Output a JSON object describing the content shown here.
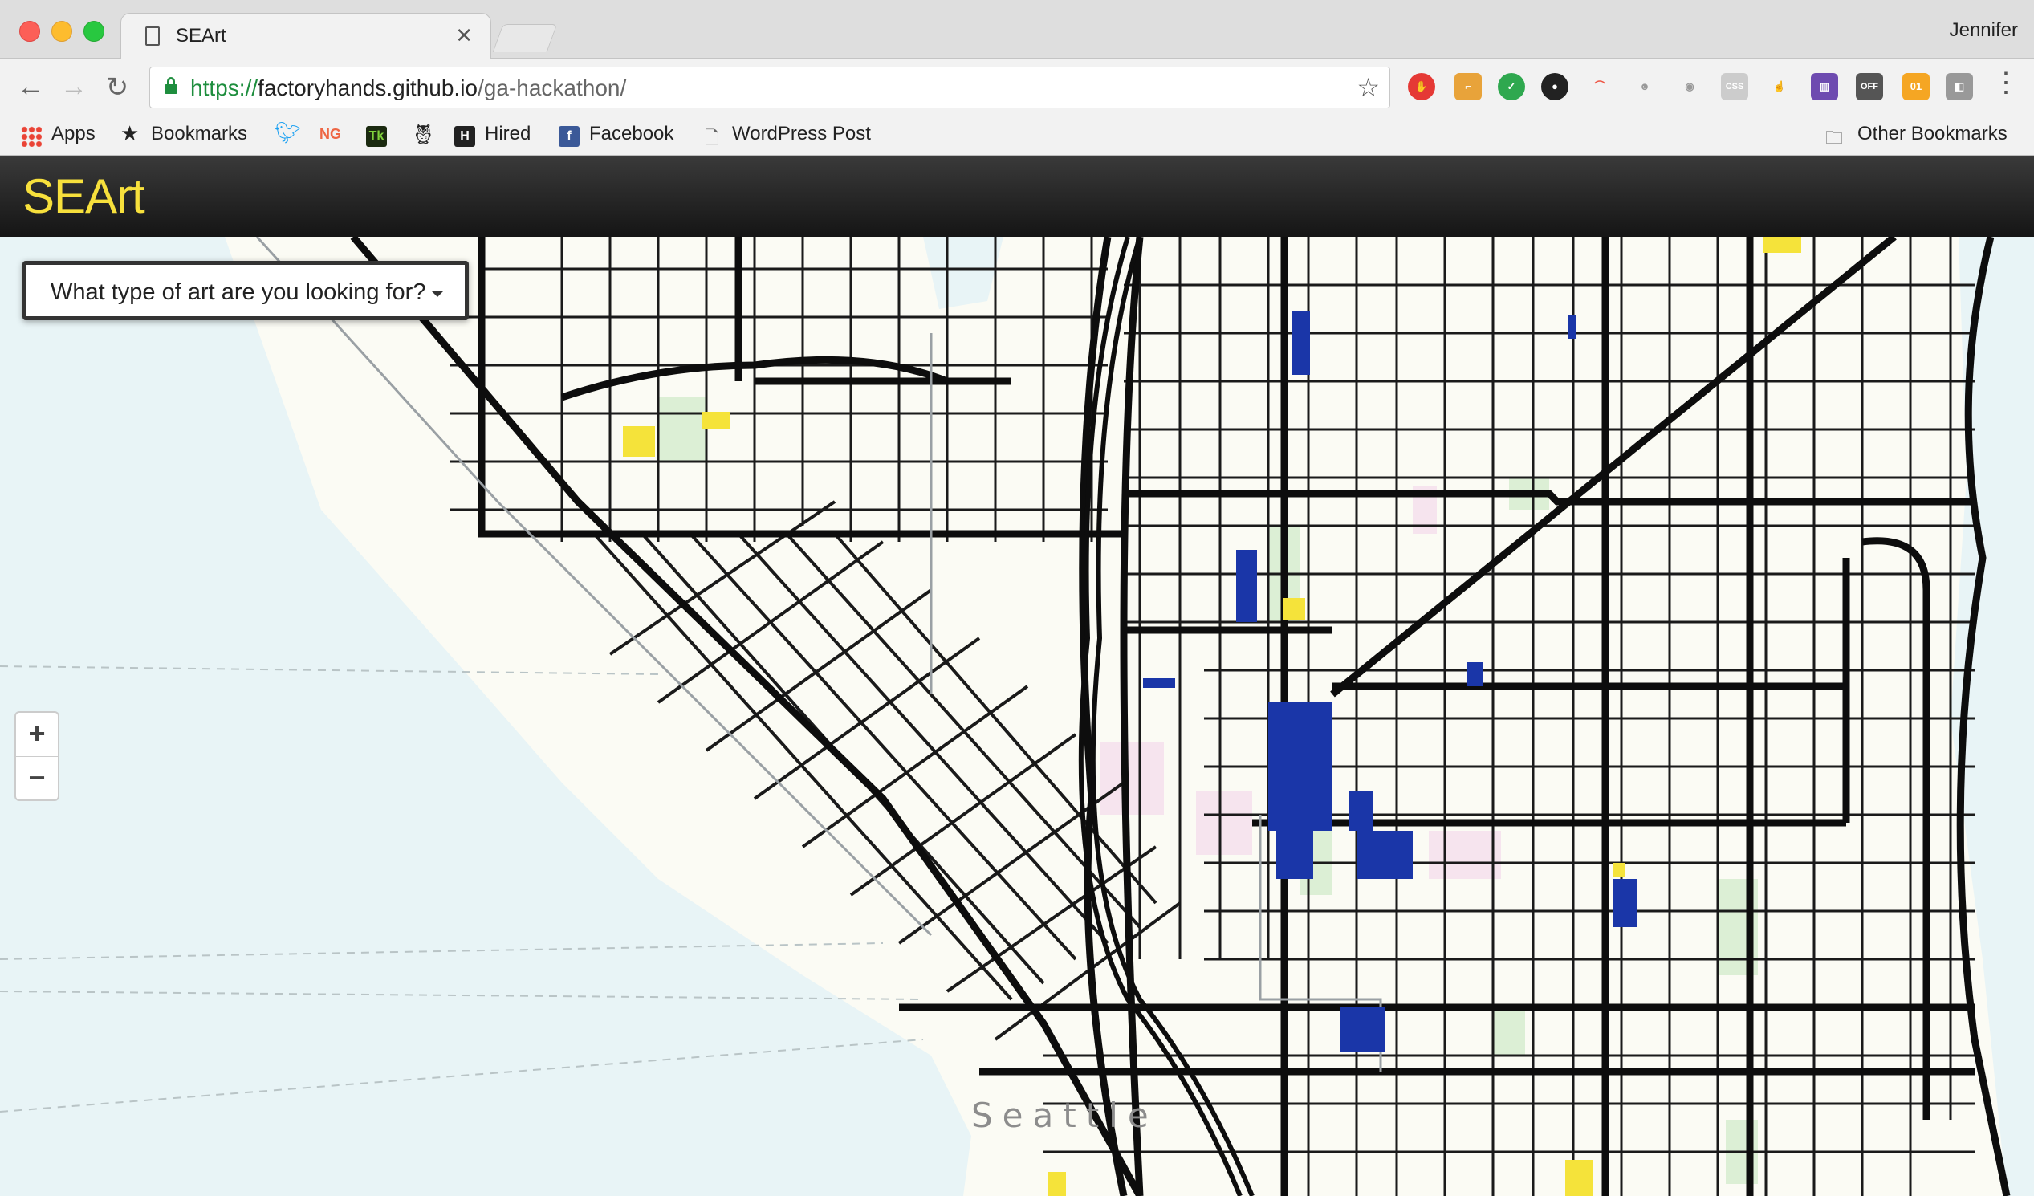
{
  "browser": {
    "tab_title": "SEArt",
    "profile_name": "Jennifer",
    "url_scheme": "https://",
    "url_host": "factoryhands.github.io",
    "url_path": "/ga-hackathon/",
    "bookmarks": {
      "apps": "Apps",
      "bookmarks": "Bookmarks",
      "ng": "NG",
      "tk": "Tk",
      "hired_icon": "H",
      "hired": "Hired",
      "facebook": "Facebook",
      "wordpress": "WordPress Post",
      "other": "Other Bookmarks"
    },
    "extension_badge": "01",
    "off_badge": "OFF",
    "css_badge": "CSS"
  },
  "app": {
    "brand": "SEArt",
    "filter_label": "What type of art are you looking for?",
    "zoom_in": "+",
    "zoom_out": "−",
    "map_city_label": "Seattle"
  },
  "colors": {
    "brand_yellow": "#f7e03c",
    "marker_blue": "#1a36a8",
    "marker_yellow": "#f5e33a",
    "water": "#e8f4f6",
    "land": "#fbfbf4",
    "roads": "#111111"
  }
}
